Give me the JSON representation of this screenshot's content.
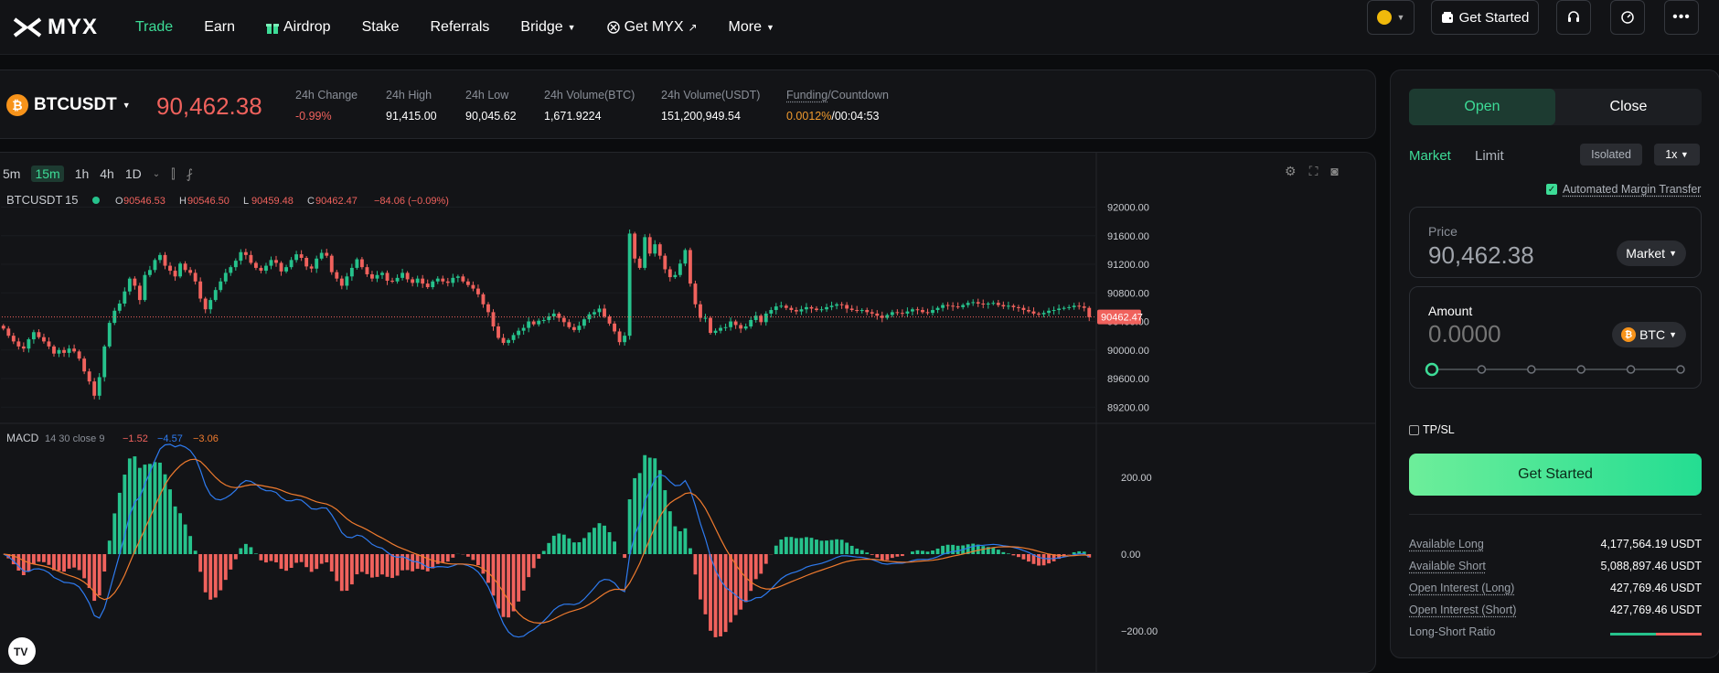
{
  "brand": {
    "name": "MYX"
  },
  "nav": [
    {
      "label": "Trade",
      "active": true
    },
    {
      "label": "Earn"
    },
    {
      "label": "Airdrop",
      "icon": "gift-icon"
    },
    {
      "label": "Stake"
    },
    {
      "label": "Referrals"
    },
    {
      "label": "Bridge",
      "dropdown": true
    },
    {
      "label": "Get MYX",
      "external": true
    },
    {
      "label": "More",
      "dropdown": true
    }
  ],
  "header_right": {
    "get_started": "Get Started",
    "icons": [
      "coin-selector-icon",
      "headset-icon",
      "gauge-icon",
      "more-icon"
    ]
  },
  "ticker": {
    "pair": "BTCUSDT",
    "last_price": "90,462.38",
    "stats": [
      {
        "label": "24h Change",
        "value": "-0.99%"
      },
      {
        "label": "24h High",
        "value": "91,415.00"
      },
      {
        "label": "24h Low",
        "value": "90,045.62"
      },
      {
        "label": "24h Volume(BTC)",
        "value": "1,671.9224"
      },
      {
        "label": "24h Volume(USDT)",
        "value": "151,200,949.54"
      }
    ],
    "funding": {
      "label_a": "Funding",
      "label_b": "/Countdown",
      "rate": "0.0012%",
      "countdown": "/00:04:53"
    }
  },
  "chart_toolbar": {
    "intervals": [
      "5m",
      "15m",
      "1h",
      "4h",
      "1D"
    ],
    "active": "15m"
  },
  "chart_data": {
    "type": "candlestick",
    "symbol": "BTCUSDT",
    "interval": "15",
    "ohlc_legend": {
      "o": "90546.53",
      "h": "90546.50",
      "l": "90459.48",
      "c": "90462.47",
      "chg": "−84.06 (−0.09%)"
    },
    "price_axis": [
      "92000.00",
      "91600.00",
      "91200.00",
      "90800.00",
      "90400.00",
      "90000.00",
      "89600.00",
      "89200.00"
    ],
    "ylim": [
      89050,
      92250
    ],
    "last_price_label": "90462.47",
    "last_price": 90462.47,
    "closes": [
      90300,
      90200,
      90120,
      90050,
      90020,
      90150,
      90250,
      90180,
      90120,
      90050,
      89950,
      90000,
      89960,
      90020,
      89980,
      89880,
      89700,
      89560,
      89360,
      89620,
      90050,
      90380,
      90550,
      90650,
      90820,
      91000,
      90900,
      90700,
      91050,
      91120,
      91260,
      91330,
      91180,
      91110,
      91030,
      91210,
      91120,
      91080,
      90960,
      90720,
      90570,
      90700,
      90840,
      90960,
      91080,
      91160,
      91250,
      91370,
      91330,
      91220,
      91150,
      91110,
      91180,
      91260,
      91220,
      91100,
      91160,
      91260,
      91340,
      91290,
      91170,
      91140,
      91280,
      91360,
      91320,
      91090,
      91000,
      90900,
      91030,
      91150,
      91270,
      91160,
      91060,
      91000,
      91050,
      91080,
      90970,
      90960,
      91010,
      91080,
      90990,
      90940,
      91000,
      90930,
      90880,
      90960,
      91000,
      90960,
      90940,
      91010,
      91030,
      90960,
      90910,
      90860,
      90780,
      90640,
      90530,
      90330,
      90170,
      90100,
      90140,
      90210,
      90270,
      90310,
      90400,
      90360,
      90410,
      90420,
      90470,
      90510,
      90450,
      90390,
      90320,
      90280,
      90340,
      90430,
      90500,
      90530,
      90580,
      90470,
      90370,
      90260,
      90110,
      90200,
      91630,
      91280,
      91150,
      91580,
      91350,
      91480,
      91320,
      91130,
      91020,
      91050,
      91210,
      91400,
      90930,
      90640,
      90450,
      90450,
      90240,
      90270,
      90310,
      90320,
      90400,
      90350,
      90300,
      90330,
      90420,
      90480,
      90390,
      90510,
      90560,
      90610,
      90620,
      90590,
      90560,
      90540,
      90570,
      90600,
      90580,
      90560,
      90570,
      90600,
      90620,
      90640,
      90630,
      90580,
      90560,
      90550,
      90560,
      90530,
      90510,
      90480,
      90450,
      90490,
      90530,
      90520,
      90510,
      90540,
      90570,
      90560,
      90530,
      90520,
      90560,
      90590,
      90630,
      90620,
      90610,
      90600,
      90630,
      90660,
      90670,
      90650,
      90640,
      90650,
      90660,
      90630,
      90610,
      90620,
      90600,
      90590,
      90560,
      90540,
      90510,
      90500,
      90520,
      90550,
      90560,
      90580,
      90590,
      90600,
      90620,
      90610,
      90590,
      90460
    ],
    "macd": {
      "label": "MACD",
      "params": "14 30 close 9",
      "values": [
        "−1.52",
        "−4.57",
        "−3.06"
      ],
      "axis": [
        "200.00",
        "0.00",
        "−200.00"
      ],
      "ylim": [
        -260,
        260
      ],
      "macd_color": "#2e7bf0",
      "signal_color": "#f07b2e"
    },
    "colors": {
      "up": "#26c28c",
      "down": "#f0625d"
    }
  },
  "order_panel": {
    "tabs": [
      "Open",
      "Close"
    ],
    "order_types": [
      "Market",
      "Limit"
    ],
    "margin_mode": "Isolated",
    "leverage": "1x",
    "auto_margin_label": "Automated Margin Transfer",
    "auto_margin_checked": true,
    "price_label": "Price",
    "price_value": "90,462.38",
    "price_mode": "Market",
    "amount_label": "Amount",
    "amount_placeholder": "0.0000",
    "amount_unit": "BTC",
    "slider_level": 0,
    "tpsl_label": "TP/SL",
    "submit": "Get Started",
    "info": [
      {
        "label": "Available Long",
        "value": "4,177,564.19 USDT"
      },
      {
        "label": "Available Short",
        "value": "5,088,897.46 USDT"
      },
      {
        "label": "Open Interest (Long)",
        "value": "427,769.46 USDT"
      },
      {
        "label": "Open Interest (Short)",
        "value": "427,769.46 USDT"
      },
      {
        "label": "Long-Short Ratio",
        "value": ""
      }
    ]
  }
}
